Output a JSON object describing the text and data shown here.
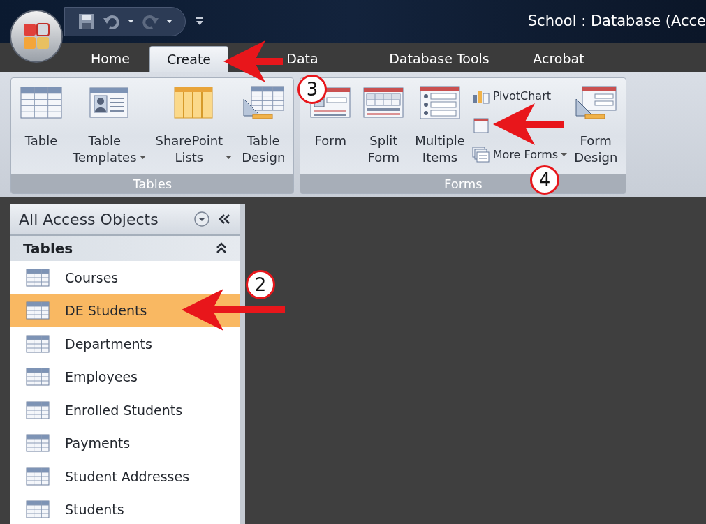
{
  "window": {
    "title": "School : Database (Acce"
  },
  "tabs": [
    {
      "label": "Home",
      "selected": false
    },
    {
      "label": "Create",
      "selected": true
    },
    {
      "label": "Data",
      "selected": false
    },
    {
      "label": "Database Tools",
      "selected": false
    },
    {
      "label": "Acrobat",
      "selected": false
    }
  ],
  "ribbon_groups": [
    {
      "label": "Tables",
      "buttons": [
        {
          "kind": "large",
          "label": "Table",
          "dropdown": false
        },
        {
          "kind": "large",
          "label": "Table Templates",
          "dropdown": true
        },
        {
          "kind": "large",
          "label": "SharePoint Lists",
          "dropdown": true
        },
        {
          "kind": "large",
          "label": "Table Design",
          "dropdown": false
        }
      ]
    },
    {
      "label": "Forms",
      "buttons": [
        {
          "kind": "large",
          "label": "Form",
          "dropdown": false
        },
        {
          "kind": "large",
          "label": "Split Form",
          "dropdown": false
        },
        {
          "kind": "large",
          "label": "Multiple Items",
          "dropdown": false
        },
        {
          "kind": "stack",
          "items": [
            {
              "label": "PivotChart",
              "dropdown": false
            },
            {
              "dropdown": false
            },
            {
              "label": "More Forms",
              "dropdown": true
            }
          ]
        },
        {
          "kind": "large",
          "label": "Form Design",
          "dropdown": false
        }
      ]
    }
  ],
  "navigation_pane": {
    "title": "All Access Objects",
    "groups": [
      {
        "label": "Tables",
        "expanded": true,
        "items": [
          {
            "label": "Courses",
            "selected": false
          },
          {
            "label": "DE Students",
            "selected": true
          },
          {
            "label": "Departments",
            "selected": false
          },
          {
            "label": "Employees",
            "selected": false
          },
          {
            "label": "Enrolled Students",
            "selected": false
          },
          {
            "label": "Payments",
            "selected": false
          },
          {
            "label": "Student Addresses",
            "selected": false
          },
          {
            "label": "Students",
            "selected": false
          }
        ]
      }
    ]
  },
  "annotations": [
    {
      "number": "3"
    },
    {
      "number": "4"
    },
    {
      "number": "2"
    }
  ]
}
